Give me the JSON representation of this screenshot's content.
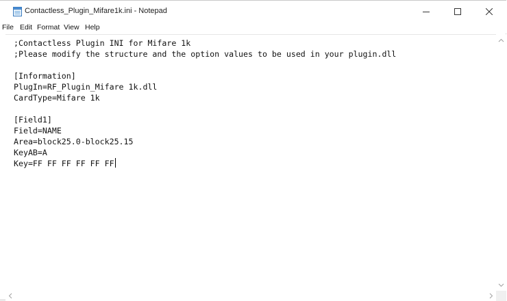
{
  "window": {
    "title": "Contactless_Plugin_Mifare1k.ini - Notepad"
  },
  "menu": {
    "items": [
      "File",
      "Edit",
      "Format",
      "View",
      "Help"
    ]
  },
  "editor": {
    "lines": [
      ";Contactless Plugin INI for Mifare 1k",
      ";Please modify the structure and the option values to be used in your plugin.dll",
      "",
      "[Information]",
      "PlugIn=RF_Plugin_Mifare 1k.dll",
      "CardType=Mifare 1k",
      "",
      "[Field1]",
      "Field=NAME",
      "Area=block25.0-block25.15",
      "KeyAB=A",
      "Key=FF FF FF FF FF FF"
    ]
  },
  "icons": {
    "app": "notepad-icon",
    "minimize": "minimize-icon",
    "maximize": "maximize-icon",
    "close": "close-icon"
  }
}
